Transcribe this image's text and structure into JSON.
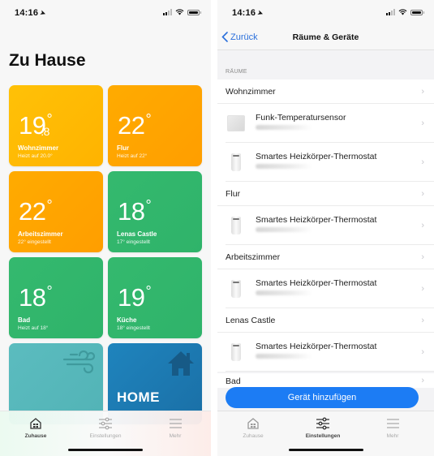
{
  "left": {
    "status": {
      "time": "14:16"
    },
    "title": "Zu Hause",
    "tiles": [
      {
        "temp": "19",
        "decimal": ".8",
        "deg": "°",
        "room": "Wohnzimmer",
        "sub": "Heizt auf 20.0°",
        "color": "#ffbb00"
      },
      {
        "temp": "22",
        "deg": "°",
        "room": "Flur",
        "sub": "Heizt auf 22°",
        "color": "#ffa600"
      },
      {
        "temp": "22",
        "deg": "°",
        "room": "Arbeitszimmer",
        "sub": "22° eingestellt",
        "color": "#ffa600"
      },
      {
        "temp": "18",
        "deg": "°",
        "room": "Lenas Castle",
        "sub": "17° eingestellt",
        "color": "#33b76c"
      },
      {
        "temp": "18",
        "deg": "°",
        "room": "Bad",
        "sub": "Heizt auf 18°",
        "color": "#33b76c"
      },
      {
        "temp": "19",
        "deg": "°",
        "room": "Küche",
        "sub": "18° eingestellt",
        "color": "#33b76c"
      },
      {
        "icon": "wind-icon",
        "color": "#57b8bb"
      },
      {
        "label": "HOME",
        "icon": "house-icon",
        "color": "#1d7ab3"
      }
    ],
    "tabbar": [
      {
        "label": "Zuhause",
        "icon": "home-grid-icon",
        "active": true
      },
      {
        "label": "Einstellungen",
        "icon": "sliders-icon",
        "active": false
      },
      {
        "label": "Mehr",
        "icon": "menu-icon",
        "active": false
      }
    ]
  },
  "right": {
    "status": {
      "time": "14:16"
    },
    "nav": {
      "back": "Zurück",
      "title": "Räume & Geräte"
    },
    "section": "RÄUME",
    "rooms": [
      {
        "name": "Wohnzimmer",
        "devices": [
          {
            "name": "Funk-Temperatursensor",
            "type": "sensor"
          },
          {
            "name": "Smartes Heizkörper-Thermostat",
            "type": "thermostat"
          }
        ]
      },
      {
        "name": "Flur",
        "devices": [
          {
            "name": "Smartes Heizkörper-Thermostat",
            "type": "thermostat"
          }
        ]
      },
      {
        "name": "Arbeitszimmer",
        "devices": [
          {
            "name": "Smartes Heizkörper-Thermostat",
            "type": "thermostat"
          }
        ]
      },
      {
        "name": "Lenas Castle",
        "devices": [
          {
            "name": "Smartes Heizkörper-Thermostat",
            "type": "thermostat"
          }
        ]
      },
      {
        "name": "Bad",
        "devices": []
      }
    ],
    "add_button": "Gerät hinzufügen",
    "accent": "#1c7cf4",
    "tabbar": [
      {
        "label": "Zuhause",
        "icon": "home-grid-icon",
        "active": false
      },
      {
        "label": "Einstellungen",
        "icon": "sliders-icon",
        "active": true
      },
      {
        "label": "Mehr",
        "icon": "menu-icon",
        "active": false
      }
    ]
  }
}
